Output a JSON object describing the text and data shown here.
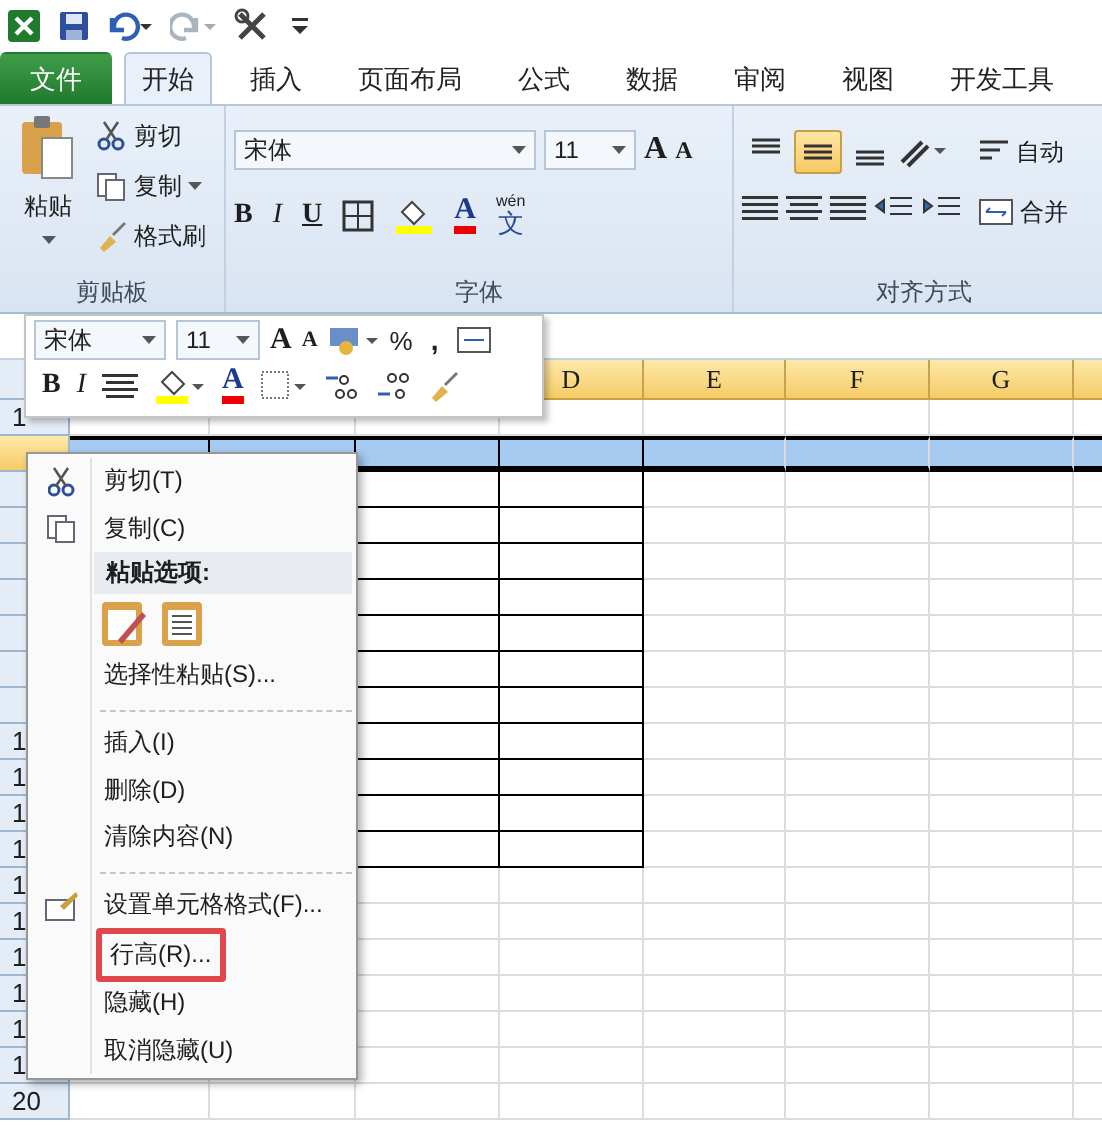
{
  "ribbon_tabs": [
    {
      "label": "文件",
      "kind": "file",
      "selected": false
    },
    {
      "label": "开始",
      "kind": "tab",
      "selected": true
    },
    {
      "label": "插入",
      "kind": "tab",
      "selected": false
    },
    {
      "label": "页面布局",
      "kind": "tab",
      "selected": false
    },
    {
      "label": "公式",
      "kind": "tab",
      "selected": false
    },
    {
      "label": "数据",
      "kind": "tab",
      "selected": false
    },
    {
      "label": "审阅",
      "kind": "tab",
      "selected": false
    },
    {
      "label": "视图",
      "kind": "tab",
      "selected": false
    },
    {
      "label": "开发工具",
      "kind": "tab",
      "selected": false
    }
  ],
  "clipboard": {
    "paste": "粘贴",
    "cut": "剪切",
    "copy": "复制",
    "painter": "格式刷",
    "group": "剪贴板"
  },
  "font": {
    "name": "宋体",
    "size": "11",
    "grow": "A",
    "shrink": "A",
    "bold": "B",
    "italic": "I",
    "underline": "U",
    "color_letter": "A",
    "phonetic_top": "wén",
    "phonetic": "文",
    "group": "字体"
  },
  "alignment": {
    "vertical": [
      {
        "kind": "top",
        "selected": false
      },
      {
        "kind": "middle",
        "selected": true
      },
      {
        "kind": "bottom",
        "selected": false
      }
    ],
    "wrap": "自动",
    "merge": "合并",
    "group": "对齐方式"
  },
  "mini_toolbar": {
    "font": "宋体",
    "size": "11",
    "grow": "A",
    "shrink": "A",
    "percent": "%",
    "comma": ",",
    "bold": "B",
    "italic": "I",
    "color_letter": "A"
  },
  "sheet": {
    "column_headers": [
      "D",
      "E",
      "F",
      "G"
    ],
    "rows": [
      {
        "header": "1",
        "selected": false,
        "bordered": false
      },
      {
        "selected": true,
        "bordered": true
      },
      {
        "selected": false,
        "bordered": true
      },
      {
        "selected": false,
        "bordered": true
      },
      {
        "selected": false,
        "bordered": true
      },
      {
        "selected": false,
        "bordered": true
      },
      {
        "selected": false,
        "bordered": true
      },
      {
        "selected": false,
        "bordered": true
      },
      {
        "selected": false,
        "bordered": true
      },
      {
        "header": "1",
        "selected": false,
        "bordered": true
      },
      {
        "header": "1",
        "selected": false,
        "bordered": true
      },
      {
        "header": "1",
        "selected": false,
        "bordered": true
      },
      {
        "header": "1",
        "selected": false,
        "bordered": true
      },
      {
        "header": "1",
        "selected": false,
        "bordered": false
      },
      {
        "header": "1",
        "selected": false,
        "bordered": false
      },
      {
        "header": "1",
        "selected": false,
        "bordered": false
      },
      {
        "header": "1",
        "selected": false,
        "bordered": false
      },
      {
        "header": "1",
        "selected": false,
        "bordered": false
      },
      {
        "header": "1",
        "selected": false,
        "bordered": false
      },
      {
        "header": "20",
        "selected": false,
        "bordered": false
      }
    ]
  },
  "context_menu": {
    "items": [
      {
        "kind": "cut",
        "label": "剪切(T)",
        "highlighted": false
      },
      {
        "kind": "copy",
        "label": "复制(C)",
        "highlighted": false
      },
      {
        "kind": "header",
        "label": "粘贴选项:",
        "highlighted": false
      },
      {
        "kind": "paste_icons"
      },
      {
        "kind": "item",
        "label": "选择性粘贴(S)...",
        "highlighted": false
      },
      {
        "kind": "separator"
      },
      {
        "kind": "item",
        "label": "插入(I)",
        "highlighted": false
      },
      {
        "kind": "item",
        "label": "删除(D)",
        "highlighted": false
      },
      {
        "kind": "item",
        "label": "清除内容(N)",
        "highlighted": false
      },
      {
        "kind": "separator"
      },
      {
        "kind": "format",
        "label": "设置单元格格式(F)...",
        "highlighted": false
      },
      {
        "kind": "item",
        "label": "行高(R)...",
        "highlighted": true
      },
      {
        "kind": "item",
        "label": "隐藏(H)",
        "highlighted": false
      },
      {
        "kind": "item",
        "label": "取消隐藏(U)",
        "highlighted": false
      }
    ]
  }
}
